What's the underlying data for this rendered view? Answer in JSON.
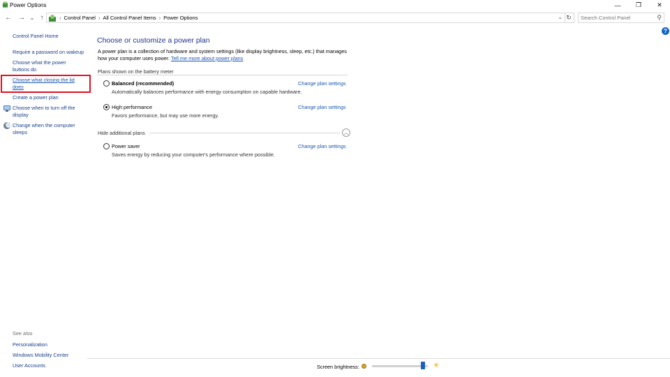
{
  "window": {
    "title": "Power Options",
    "minimize": "—",
    "maximize": "❐",
    "close": "✕"
  },
  "nav": {
    "back": "←",
    "forward": "→",
    "recent": "⌄",
    "up": "↑",
    "breadcrumbs": [
      "Control Panel",
      "All Control Panel Items",
      "Power Options"
    ],
    "breadcrumb_separator": "›",
    "refresh": "↻",
    "search_placeholder": "Search Control Panel"
  },
  "help": "?",
  "sidebar": {
    "home": "Control Panel Home",
    "items": [
      {
        "label": "Require a password on wakeup"
      },
      {
        "label": "Choose what the power buttons do"
      },
      {
        "label": "Choose what closing the lid does",
        "highlighted": true
      },
      {
        "label": "Create a power plan"
      },
      {
        "label": "Choose when to turn off the display",
        "icon": "display-icon"
      },
      {
        "label": "Change when the computer sleeps",
        "icon": "moon-icon"
      }
    ],
    "see_also": "See also",
    "see_also_items": [
      "Personalization",
      "Windows Mobility Center",
      "User Accounts"
    ]
  },
  "main": {
    "heading": "Choose or customize a power plan",
    "description": "A power plan is a collection of hardware and system settings (like display brightness, sleep, etc.) that manages how your computer uses power.",
    "description_link": "Tell me more about power plans",
    "group_battery": "Plans shown on the battery meter",
    "group_hidden": "Hide additional plans",
    "plans": [
      {
        "name": "Balanced (recommended)",
        "description": "Automatically balances performance with energy consumption on capable hardware.",
        "link": "Change plan settings",
        "selected": false
      },
      {
        "name": "High performance",
        "description": "Favors performance, but may use more energy.",
        "link": "Change plan settings",
        "selected": true
      },
      {
        "name": "Power saver",
        "description": "Saves energy by reducing your computer's performance where possible.",
        "link": "Change plan settings",
        "selected": false
      }
    ]
  },
  "bottom": {
    "brightness_label": "Screen brightness:",
    "brightness_level": 0.95
  },
  "colors": {
    "accent": "#1b5fbf",
    "link": "#1a56b0",
    "heading": "#1e3287",
    "highlight_box": "#e3101e"
  }
}
